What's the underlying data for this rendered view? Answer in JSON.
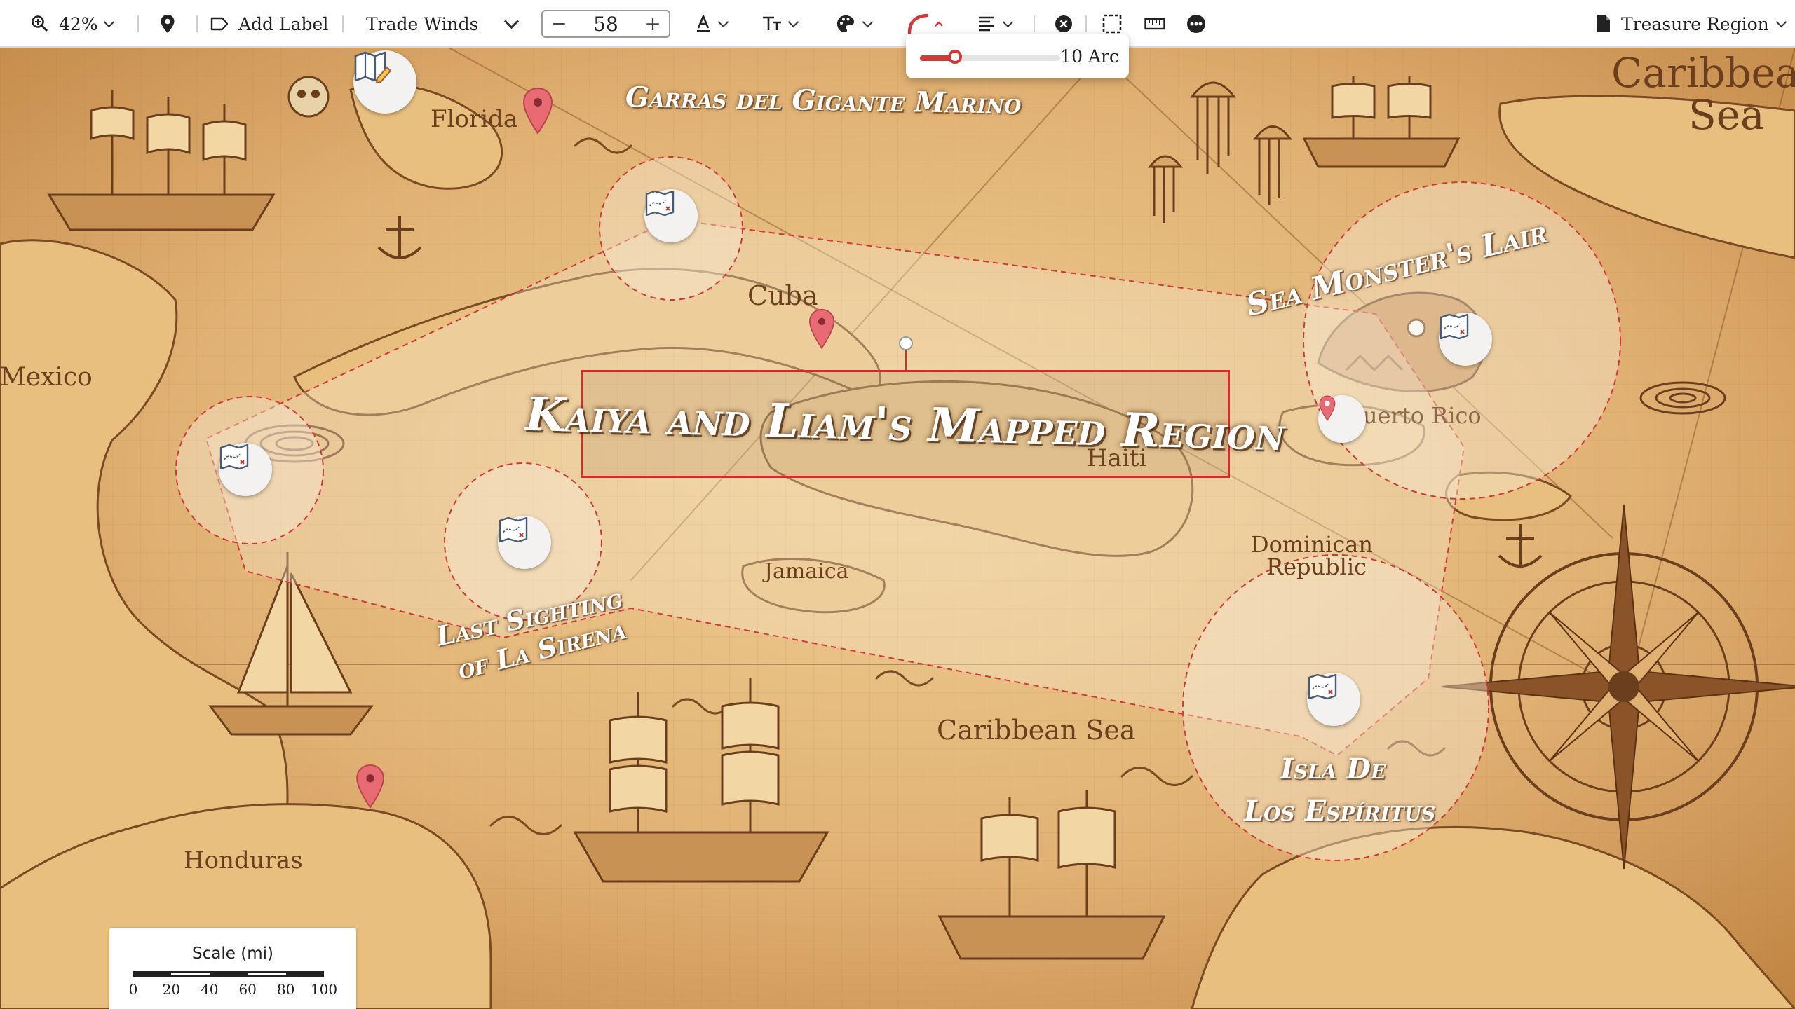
{
  "toolbar": {
    "zoom": "42%",
    "add_label": "Add Label",
    "font_name": "Trade Winds",
    "font_size": "58",
    "stepper_minus": "−",
    "stepper_plus": "+",
    "document_title": "Treasure Region"
  },
  "arc_popover": {
    "value": 10,
    "max": 40,
    "label": "10 Arc",
    "color": "#d13838"
  },
  "map": {
    "region_title": "Kaiya and Liam's Mapped Region",
    "region_outline_color": "#d22c2c",
    "curved_labels": {
      "garras": "Garras del Gigante Marino",
      "sea_monster": "Sea Monster's Lair",
      "last_sighting_line1": "Last Sighting",
      "last_sighting_line2": "of La Sirena",
      "isla_line1": "Isla De",
      "isla_line2": "Los Espíritus"
    },
    "place_labels": {
      "florida": "Florida",
      "cuba": "Cuba",
      "mexico": "Mexico",
      "puerto_rico": "uerto Rico",
      "haiti": "Haiti",
      "dominican": "Dominican",
      "republic": "Republic",
      "jamaica": "Jamaica",
      "caribbean_sea": "Caribbean Sea",
      "honduras": "Honduras",
      "caribbean_corner_1": "Caribbea",
      "caribbean_corner_2": "Sea"
    }
  },
  "scale": {
    "title": "Scale (mi)",
    "ticks": [
      "0",
      "20",
      "40",
      "60",
      "80",
      "100"
    ]
  }
}
